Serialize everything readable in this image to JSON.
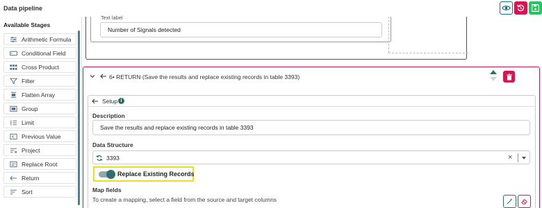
{
  "app": {
    "title": "Data pipeline"
  },
  "header_actions": {
    "view_icon": "eye-icon",
    "revert_icon": "revert-icon",
    "save_icon": "save-icon",
    "colors": {
      "view": "#0e7490",
      "revert": "#d6174f",
      "save": "#22c55e"
    }
  },
  "sidebar": {
    "title": "Available Stages",
    "items": [
      {
        "label": "Arithmetic Formula",
        "icon": "formula-icon"
      },
      {
        "label": "Conditional Field",
        "icon": "field-icon"
      },
      {
        "label": "Cross Product",
        "icon": "grid-icon"
      },
      {
        "label": "Filter",
        "icon": "filter-icon"
      },
      {
        "label": "Flatten Array",
        "icon": "flatten-icon"
      },
      {
        "label": "Group",
        "icon": "group-icon"
      },
      {
        "label": "Limit",
        "icon": "limit-icon"
      },
      {
        "label": "Previous Value",
        "icon": "previous-value-icon"
      },
      {
        "label": "Project",
        "icon": "project-icon"
      },
      {
        "label": "Replace Root",
        "icon": "replace-root-icon"
      },
      {
        "label": "Return",
        "icon": "return-icon"
      },
      {
        "label": "Sort",
        "icon": "sort-icon"
      }
    ]
  },
  "previous_stage": {
    "text_label_caption": "Text label",
    "text_label_value": "Number of Signals detected"
  },
  "stage": {
    "header_title": "6• RETURN (Save the results and replace existing records in table 3393)",
    "setup_title": "Setup",
    "description_label": "Description",
    "description_value": "Save the results and replace existing records in table 3393",
    "data_structure_label": "Data Structure",
    "data_structure_value": "3393",
    "replace_toggle_label": "Replace Existing Records",
    "replace_toggle_on": true,
    "map_fields_label": "Map fields",
    "map_fields_help": "To create a mapping, select a field from the source and target columns"
  },
  "colors": {
    "accent": "#2e6e6e",
    "danger": "#d6174f",
    "highlight": "#e8e020"
  }
}
